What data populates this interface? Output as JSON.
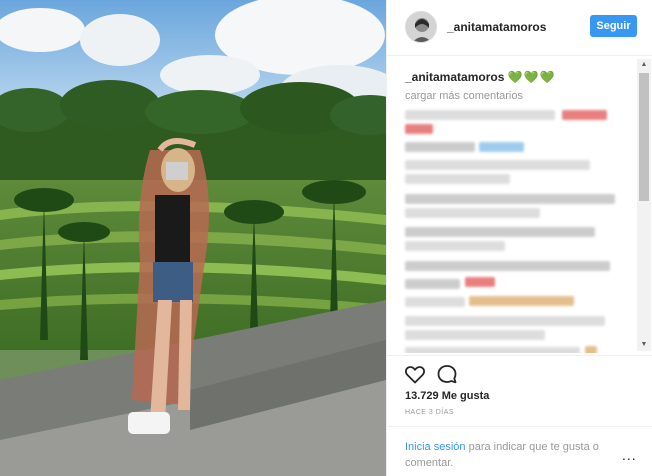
{
  "post": {
    "username": "_anitamatamoros",
    "follow_label": "Seguir",
    "caption_user": "_anitamatamoros",
    "caption_text": "💚💚💚",
    "load_more": "cargar más comentarios",
    "likes": "13.729 Me gusta",
    "time": "HACE 3 DÍAS",
    "login_link": "Inicia sesión",
    "login_text": " para indicar que te gusta o comentar.",
    "more_icon": "..."
  },
  "icons": {
    "like": "heart-icon",
    "comment": "comment-icon",
    "more": "more-options-icon"
  },
  "colors": {
    "accent": "#3897f0",
    "caption_hearts": "#3bc23b"
  }
}
